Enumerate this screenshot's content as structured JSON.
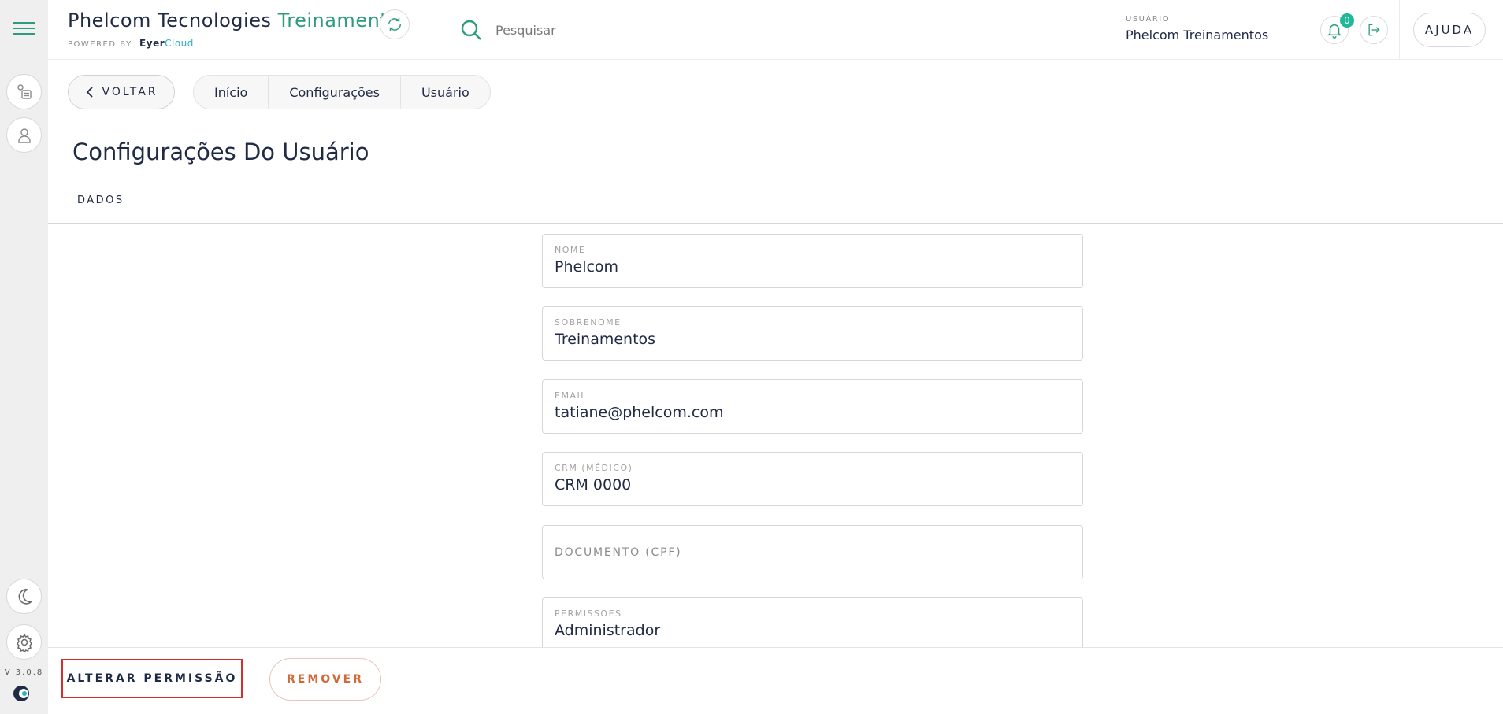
{
  "sidebar": {
    "version": "V 3.0.8",
    "icons": [
      "hamburger-menu-icon",
      "exams-list-icon",
      "patients-icon",
      "dark-mode-icon",
      "settings-gear-icon",
      "eyercloud-logo-icon"
    ]
  },
  "header": {
    "brand_main": "Phelcom Tecnologies",
    "brand_accent": "Treinamentos",
    "powered_by": "POWERED BY",
    "powered_eyer": "Eyer",
    "powered_cloud": "Cloud",
    "search_placeholder": "Pesquisar",
    "user_label": "USUÁRIO",
    "user_name": "Phelcom Treinamentos",
    "notification_count": "0",
    "help_label": "AJUDA"
  },
  "nav": {
    "back_label": "VOLTAR",
    "breadcrumbs": [
      "Início",
      "Configurações",
      "Usuário"
    ]
  },
  "page": {
    "title": "Configurações Do Usuário",
    "tab": "DADOS"
  },
  "form": {
    "fields": [
      {
        "label": "NOME",
        "value": "Phelcom"
      },
      {
        "label": "SOBRENOME",
        "value": "Treinamentos"
      },
      {
        "label": "EMAIL",
        "value": "tatiane@phelcom.com"
      },
      {
        "label": "CRM (MÉDICO)",
        "value": "CRM 0000"
      },
      {
        "label": "DOCUMENTO (CPF)",
        "value": ""
      },
      {
        "label": "PERMISSÕES",
        "value": "Administrador"
      }
    ]
  },
  "footer": {
    "alter_permission_label": "ALTERAR PERMISSÃO",
    "remove_label": "REMOVER"
  },
  "colors": {
    "accent_green": "#2e9b7e",
    "badge_green": "#1fb899",
    "remove_orange": "#d06a3a",
    "highlight_red": "#d32f2f"
  }
}
